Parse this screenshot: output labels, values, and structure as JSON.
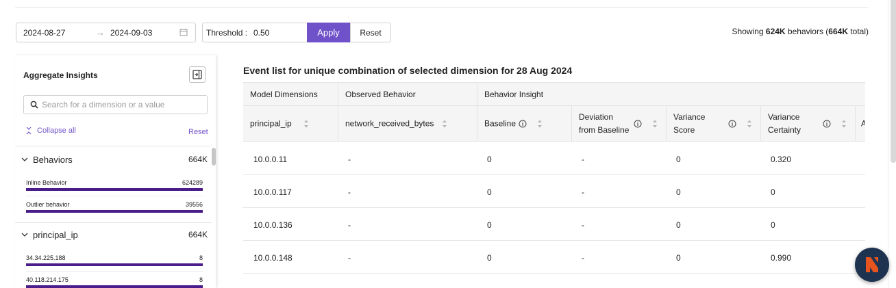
{
  "toolbar": {
    "date_start": "2024-08-27",
    "date_arrow": "→",
    "date_end": "2024-09-03",
    "threshold_label": "Threshold :",
    "threshold_value": "0.50",
    "apply_label": "Apply",
    "reset_label": "Reset",
    "showing_prefix": "Showing ",
    "showing_count": "624K",
    "showing_middle": " behaviors (",
    "showing_total": "664K",
    "showing_suffix": " total)"
  },
  "sidebar": {
    "title": "Aggregate Insights",
    "search_placeholder": "Search for a dimension or a value",
    "collapse_all": "Collapse all",
    "reset": "Reset",
    "groups": [
      {
        "label": "Behaviors",
        "count": "664K",
        "items": [
          {
            "label": "Inline Behavior",
            "value": "624289",
            "fill": 1.0
          },
          {
            "label": "Outlier behavior",
            "value": "39556",
            "fill": 1.0
          }
        ]
      },
      {
        "label": "principal_ip",
        "count": "664K",
        "items": [
          {
            "label": "34.34.225.188",
            "value": "8",
            "fill": 1.0
          },
          {
            "label": "40.118.214.175",
            "value": "8",
            "fill": 1.0
          }
        ]
      }
    ]
  },
  "main": {
    "title": "Event list for unique combination of selected dimension for 28 Aug 2024",
    "header_groups": [
      "Model Dimensions",
      "Observed Behavior",
      "Behavior Insight"
    ],
    "columns": [
      "principal_ip",
      "network_received_bytes",
      "Baseline",
      "Deviation\nfrom Baseline",
      "Variance\nScore",
      "Variance\nCertainty",
      "A"
    ],
    "rows": [
      [
        "10.0.0.11",
        "-",
        "0",
        "-",
        "0",
        "0.320"
      ],
      [
        "10.0.0.117",
        "-",
        "0",
        "-",
        "0",
        "0"
      ],
      [
        "10.0.0.136",
        "-",
        "0",
        "-",
        "0",
        "0"
      ],
      [
        "10.0.0.148",
        "-",
        "0",
        "-",
        "0",
        "0.990"
      ]
    ]
  },
  "colors": {
    "accent": "#6f52c9",
    "bar_fill": "#4b1d8a",
    "fab_bg": "#1e3350",
    "fab_logo": "#e8541e"
  }
}
